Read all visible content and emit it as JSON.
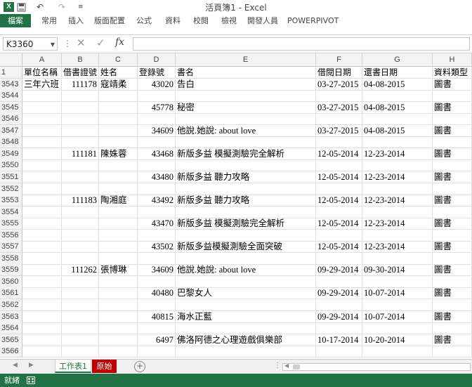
{
  "window": {
    "title": "活頁簿1 - Excel",
    "logo": "X",
    "undo": "↶",
    "redo": "↷",
    "customize": "≡"
  },
  "ribbon": {
    "tabs": [
      "檔案",
      "常用",
      "插入",
      "版面配置",
      "公式",
      "資料",
      "校閱",
      "檢視",
      "開發人員",
      "POWERPIVOT"
    ]
  },
  "formula_bar": {
    "name_box": "K3360",
    "dropdown": "▼",
    "separator": "⋮",
    "cancel": "✕",
    "enter": "✓",
    "fx": "fx",
    "value": ""
  },
  "grid": {
    "columns": [
      "A",
      "B",
      "C",
      "D",
      "E",
      "F",
      "G",
      "H"
    ],
    "header_row": {
      "row": "1",
      "cells": [
        "單位名稱",
        "借書證號",
        "姓名",
        "登錄號",
        "書名",
        "借閱日期",
        "還書日期",
        "資料類型"
      ]
    },
    "rows": [
      {
        "row": "3543",
        "cells": [
          "三年六班",
          "111178",
          "寇靖柔",
          "43020",
          "告白",
          "03-27-2015",
          "04-08-2015",
          "圖書"
        ]
      },
      {
        "row": "3544",
        "cells": [
          "",
          "",
          "",
          "",
          "",
          "",
          "",
          ""
        ]
      },
      {
        "row": "3545",
        "cells": [
          "",
          "",
          "",
          "45778",
          "秘密",
          "03-27-2015",
          "04-08-2015",
          "圖書"
        ]
      },
      {
        "row": "3546",
        "cells": [
          "",
          "",
          "",
          "",
          "",
          "",
          "",
          ""
        ]
      },
      {
        "row": "3547",
        "cells": [
          "",
          "",
          "",
          "34609",
          "他說.她說: about love",
          "03-27-2015",
          "04-08-2015",
          "圖書"
        ]
      },
      {
        "row": "3548",
        "cells": [
          "",
          "",
          "",
          "",
          "",
          "",
          "",
          ""
        ]
      },
      {
        "row": "3549",
        "cells": [
          "",
          "111181",
          "陳姝蓉",
          "43468",
          "新版多益 模擬測驗完全解析",
          "12-05-2014",
          "12-23-2014",
          "圖書"
        ]
      },
      {
        "row": "3550",
        "cells": [
          "",
          "",
          "",
          "",
          "",
          "",
          "",
          ""
        ]
      },
      {
        "row": "3551",
        "cells": [
          "",
          "",
          "",
          "43480",
          "新版多益 聽力攻略",
          "12-05-2014",
          "12-23-2014",
          "圖書"
        ]
      },
      {
        "row": "3552",
        "cells": [
          "",
          "",
          "",
          "",
          "",
          "",
          "",
          ""
        ]
      },
      {
        "row": "3553",
        "cells": [
          "",
          "111183",
          "陶湘庭",
          "43492",
          "新版多益 聽力攻略",
          "12-05-2014",
          "12-23-2014",
          "圖書"
        ]
      },
      {
        "row": "3554",
        "cells": [
          "",
          "",
          "",
          "",
          "",
          "",
          "",
          ""
        ]
      },
      {
        "row": "3555",
        "cells": [
          "",
          "",
          "",
          "43470",
          "新版多益 模擬測驗完全解析",
          "12-05-2014",
          "12-23-2014",
          "圖書"
        ]
      },
      {
        "row": "3556",
        "cells": [
          "",
          "",
          "",
          "",
          "",
          "",
          "",
          ""
        ]
      },
      {
        "row": "3557",
        "cells": [
          "",
          "",
          "",
          "43502",
          "新版多益模擬測驗全面突破",
          "12-05-2014",
          "12-23-2014",
          "圖書"
        ]
      },
      {
        "row": "3558",
        "cells": [
          "",
          "",
          "",
          "",
          "",
          "",
          "",
          ""
        ]
      },
      {
        "row": "3559",
        "cells": [
          "",
          "111262",
          "張博琳",
          "34609",
          "他說.她說: about love",
          "09-29-2014",
          "09-30-2014",
          "圖書"
        ]
      },
      {
        "row": "3560",
        "cells": [
          "",
          "",
          "",
          "",
          "",
          "",
          "",
          ""
        ]
      },
      {
        "row": "3561",
        "cells": [
          "",
          "",
          "",
          "40480",
          "巴黎女人",
          "09-29-2014",
          "10-07-2014",
          "圖書"
        ]
      },
      {
        "row": "3562",
        "cells": [
          "",
          "",
          "",
          "",
          "",
          "",
          "",
          ""
        ]
      },
      {
        "row": "3563",
        "cells": [
          "",
          "",
          "",
          "40815",
          "海水正藍",
          "09-29-2014",
          "10-07-2014",
          "圖書"
        ]
      },
      {
        "row": "3564",
        "cells": [
          "",
          "",
          "",
          "",
          "",
          "",
          "",
          ""
        ]
      },
      {
        "row": "3565",
        "cells": [
          "",
          "",
          "",
          "6497",
          "佛洛阿德之心理遊戲俱樂部",
          "10-17-2014",
          "10-20-2014",
          "圖書"
        ]
      },
      {
        "row": "3566",
        "cells": [
          "",
          "",
          "",
          "",
          "",
          "",
          "",
          ""
        ]
      }
    ]
  },
  "sheets": {
    "nav_prev": "◀",
    "nav_next": "▶",
    "tabs": [
      "工作表1",
      "原始"
    ],
    "add": "+",
    "more": "⋮",
    "scroll_left": "◀"
  },
  "status": {
    "text": "就緒"
  },
  "colors": {
    "accent": "#217346",
    "red_tab": "#c00000"
  }
}
